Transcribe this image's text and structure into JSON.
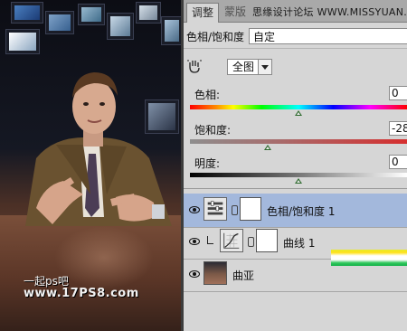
{
  "photo": {
    "watermark_line1": "一起ps吧",
    "watermark_line2": "www.17PS8.com"
  },
  "panel": {
    "tabs": [
      {
        "label": "调整",
        "active": true
      },
      {
        "label": "蒙版",
        "active": false
      }
    ],
    "site_label": "思缘设计论坛  WWW.MISSYUAN.COM",
    "adjustment_title": "色相/饱和度",
    "preset_value": "自定",
    "channel_value": "全图",
    "sliders": {
      "hue": {
        "label": "色相:",
        "value": "0",
        "position": 0.5
      },
      "saturation": {
        "label": "饱和度:",
        "value": "-28",
        "position": 0.36
      },
      "lightness": {
        "label": "明度:",
        "value": "0",
        "position": 0.5
      }
    }
  },
  "layers": [
    {
      "name": "色相/饱和度 1",
      "selected": true,
      "type": "hue-saturation"
    },
    {
      "name": "曲线 1",
      "selected": false,
      "type": "curves",
      "clipped": true
    },
    {
      "name": "曲亚",
      "selected": false,
      "type": "image"
    }
  ],
  "colors": {
    "panel_bg": "#d6d6d6",
    "selected_layer": "#a3b8dc",
    "tab_bar": "#a9a9a9",
    "thumb_green": "#2f6b2f"
  }
}
